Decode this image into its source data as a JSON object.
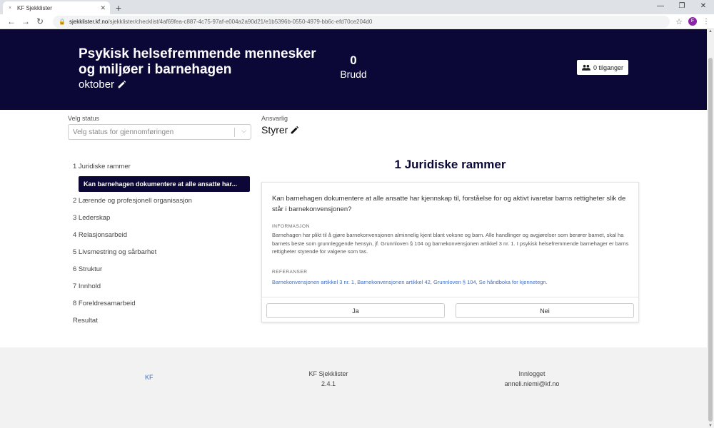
{
  "browser": {
    "tab_title": "KF Sjekklister",
    "new_tab": "+",
    "url_host": "sjekklister.kf.no",
    "url_path": "/sjekklister/checklist/4af69fea-c887-4c75-97af-e004a2a90d21/e1b5396b-0550-4979-bb6c-efd70ce204d0",
    "profile_initial": "F"
  },
  "header": {
    "title": "Psykisk helsefremmende mennesker og miljøer i barnehagen",
    "month": "oktober",
    "brudd_count": "0",
    "brudd_label": "Brudd",
    "access_button": "0 tilganger"
  },
  "status": {
    "label": "Velg status",
    "placeholder": "Velg status for gjennomføringen"
  },
  "responsible": {
    "label": "Ansvarlig",
    "value": "Styrer"
  },
  "sidenav": {
    "items": [
      {
        "label": "1 Juridiske rammer"
      },
      {
        "label": "2 Lærende og profesjonell organisasjon"
      },
      {
        "label": "3 Lederskap"
      },
      {
        "label": "4 Relasjonsarbeid"
      },
      {
        "label": "5 Livsmestring og sårbarhet"
      },
      {
        "label": "6 Struktur"
      },
      {
        "label": "7 Innhold"
      },
      {
        "label": "8 Foreldresamarbeid"
      },
      {
        "label": "Resultat"
      }
    ],
    "active_sub": "Kan barnehagen dokumentere at alle ansatte har..."
  },
  "main": {
    "section_title": "1 Juridiske rammer",
    "question": "Kan barnehagen dokumentere at alle ansatte har kjennskap til, forståelse for og aktivt ivaretar barns rettigheter slik de står i barnekonvensjonen?",
    "info_heading": "INFORMASJON",
    "info_text": "Barnehagen har plikt til å gjøre barnekonvensjonen alminnelig kjent blant voksne og barn. Alle handlinger og avgjørelser som berører barnet, skal ha barnets beste som grunnleggende hensyn, jf. Grunnloven § 104 og barnekonvensjonen artikkel 3 nr. 1. I psykisk helsefremmende barnehager er barns rettigheter styrende for valgene som tas.",
    "ref_heading": "REFERANSER",
    "references": "Barnekonvensjonen artikkel 3 nr. 1, Barnekonvensjonen artikkel 42, Grunnloven § 104, Se håndboka for kjennetegn.",
    "yes_label": "Ja",
    "no_label": "Nei"
  },
  "footer": {
    "brand": "KF",
    "app_name": "KF Sjekklister",
    "version": "2.4.1",
    "login_label": "Innlogget",
    "user_email": "anneli.niemi@kf.no"
  },
  "colors": {
    "header_bg": "#0b0838",
    "link": "#3d6fc9",
    "footer_bg": "#f2f2f2"
  }
}
